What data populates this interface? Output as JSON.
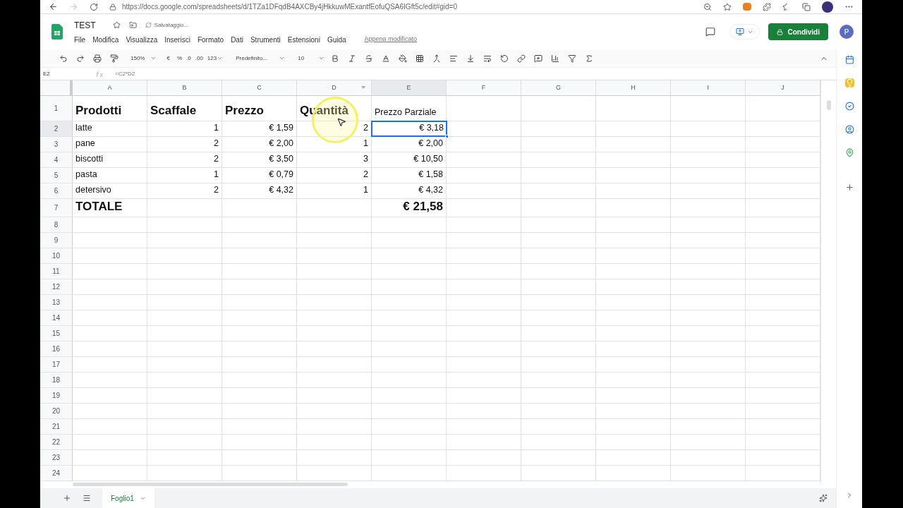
{
  "browser": {
    "url": "https://docs.google.com/spreadsheets/d/1TZa1DFqdB4AXCBy4jHkkuwMExantfEofuQSA6IGft5c/edit#gid=0"
  },
  "doc": {
    "title": "TEST",
    "save_status": "Salvataggio...",
    "last_edit": "Appena modificato",
    "share_label": "Condividi",
    "avatar": "P"
  },
  "menu": [
    "File",
    "Modifica",
    "Visualizza",
    "Inserisci",
    "Formato",
    "Dati",
    "Strumenti",
    "Estensioni",
    "Guida"
  ],
  "toolbar": {
    "zoom": "150%",
    "currency": "€",
    "percent": "%",
    "dec_less": ".0",
    "dec_more": ".00",
    "format": "123",
    "font": "Predefinito...",
    "size": "10"
  },
  "formula_bar": {
    "cell_ref": "E2",
    "formula": "=C2*D2"
  },
  "columns": [
    {
      "label": "A",
      "selected": false,
      "hovered": false
    },
    {
      "label": "B",
      "selected": false,
      "hovered": false
    },
    {
      "label": "C",
      "selected": false,
      "hovered": false
    },
    {
      "label": "D",
      "selected": false,
      "hovered": true
    },
    {
      "label": "E",
      "selected": true,
      "hovered": false
    },
    {
      "label": "F",
      "selected": false,
      "hovered": false
    },
    {
      "label": "G",
      "selected": false,
      "hovered": false
    },
    {
      "label": "H",
      "selected": false,
      "hovered": false
    },
    {
      "label": "I",
      "selected": false,
      "hovered": false
    },
    {
      "label": "J",
      "selected": false,
      "hovered": false
    }
  ],
  "rows": [
    {
      "number": "1",
      "kind": "tall",
      "selected": false,
      "cells": [
        {
          "text": "Prodotti",
          "kind": "heading",
          "selected": false
        },
        {
          "text": "Scaffale",
          "kind": "heading",
          "selected": false
        },
        {
          "text": "Prezzo",
          "kind": "heading",
          "selected": false
        },
        {
          "text": "Quantità",
          "kind": "heading",
          "selected": false
        },
        {
          "text": "Prezzo Parziale",
          "kind": "text",
          "selected": false
        }
      ]
    },
    {
      "number": "2",
      "kind": "normal",
      "selected": true,
      "cells": [
        {
          "text": "latte",
          "kind": "text",
          "selected": false
        },
        {
          "text": "1",
          "kind": "number",
          "selected": false
        },
        {
          "text": "€ 1,59",
          "kind": "number",
          "selected": false
        },
        {
          "text": "2",
          "kind": "number",
          "selected": false
        },
        {
          "text": "€ 3,18",
          "kind": "number",
          "selected": true
        }
      ]
    },
    {
      "number": "3",
      "kind": "normal",
      "selected": false,
      "cells": [
        {
          "text": "pane",
          "kind": "text",
          "selected": false
        },
        {
          "text": "2",
          "kind": "number",
          "selected": false
        },
        {
          "text": "€ 2,00",
          "kind": "number",
          "selected": false
        },
        {
          "text": "1",
          "kind": "number",
          "selected": false
        },
        {
          "text": "€ 2,00",
          "kind": "number",
          "selected": false
        }
      ]
    },
    {
      "number": "4",
      "kind": "normal",
      "selected": false,
      "cells": [
        {
          "text": "biscotti",
          "kind": "text",
          "selected": false
        },
        {
          "text": "2",
          "kind": "number",
          "selected": false
        },
        {
          "text": "€ 3,50",
          "kind": "number",
          "selected": false
        },
        {
          "text": "3",
          "kind": "number",
          "selected": false
        },
        {
          "text": "€ 10,50",
          "kind": "number",
          "selected": false
        }
      ]
    },
    {
      "number": "5",
      "kind": "normal",
      "selected": false,
      "cells": [
        {
          "text": "pasta",
          "kind": "text",
          "selected": false
        },
        {
          "text": "1",
          "kind": "number",
          "selected": false
        },
        {
          "text": "€ 0,79",
          "kind": "number",
          "selected": false
        },
        {
          "text": "2",
          "kind": "number",
          "selected": false
        },
        {
          "text": "€ 1,58",
          "kind": "number",
          "selected": false
        }
      ]
    },
    {
      "number": "6",
      "kind": "normal",
      "selected": false,
      "cells": [
        {
          "text": "detersivo",
          "kind": "text",
          "selected": false
        },
        {
          "text": "2",
          "kind": "number",
          "selected": false
        },
        {
          "text": "€ 4,32",
          "kind": "number",
          "selected": false
        },
        {
          "text": "1",
          "kind": "number",
          "selected": false
        },
        {
          "text": "€ 4,32",
          "kind": "number",
          "selected": false
        }
      ]
    },
    {
      "number": "7",
      "kind": "total",
      "selected": false,
      "cells": [
        {
          "text": "TOTALE",
          "kind": "heading",
          "selected": false
        },
        null,
        null,
        null,
        {
          "text": "€ 21,58",
          "kind": "heading_number",
          "selected": false
        }
      ]
    },
    {
      "number": "8",
      "kind": "normal",
      "selected": false,
      "cells": []
    },
    {
      "number": "9",
      "kind": "normal",
      "selected": false,
      "cells": []
    },
    {
      "number": "10",
      "kind": "normal",
      "selected": false,
      "cells": []
    },
    {
      "number": "11",
      "kind": "normal",
      "selected": false,
      "cells": []
    },
    {
      "number": "12",
      "kind": "normal",
      "selected": false,
      "cells": []
    },
    {
      "number": "13",
      "kind": "normal",
      "selected": false,
      "cells": []
    },
    {
      "number": "14",
      "kind": "normal",
      "selected": false,
      "cells": []
    },
    {
      "number": "15",
      "kind": "normal",
      "selected": false,
      "cells": []
    },
    {
      "number": "16",
      "kind": "normal",
      "selected": false,
      "cells": []
    },
    {
      "number": "17",
      "kind": "normal",
      "selected": false,
      "cells": []
    },
    {
      "number": "18",
      "kind": "normal",
      "selected": false,
      "cells": []
    },
    {
      "number": "19",
      "kind": "normal",
      "selected": false,
      "cells": []
    },
    {
      "number": "20",
      "kind": "normal",
      "selected": false,
      "cells": []
    },
    {
      "number": "21",
      "kind": "normal",
      "selected": false,
      "cells": []
    },
    {
      "number": "22",
      "kind": "normal",
      "selected": false,
      "cells": []
    },
    {
      "number": "23",
      "kind": "normal",
      "selected": false,
      "cells": []
    },
    {
      "number": "24",
      "kind": "normal",
      "selected": false,
      "cells": []
    }
  ],
  "sheets": [
    {
      "name": "Foglio1",
      "selected": true
    }
  ]
}
